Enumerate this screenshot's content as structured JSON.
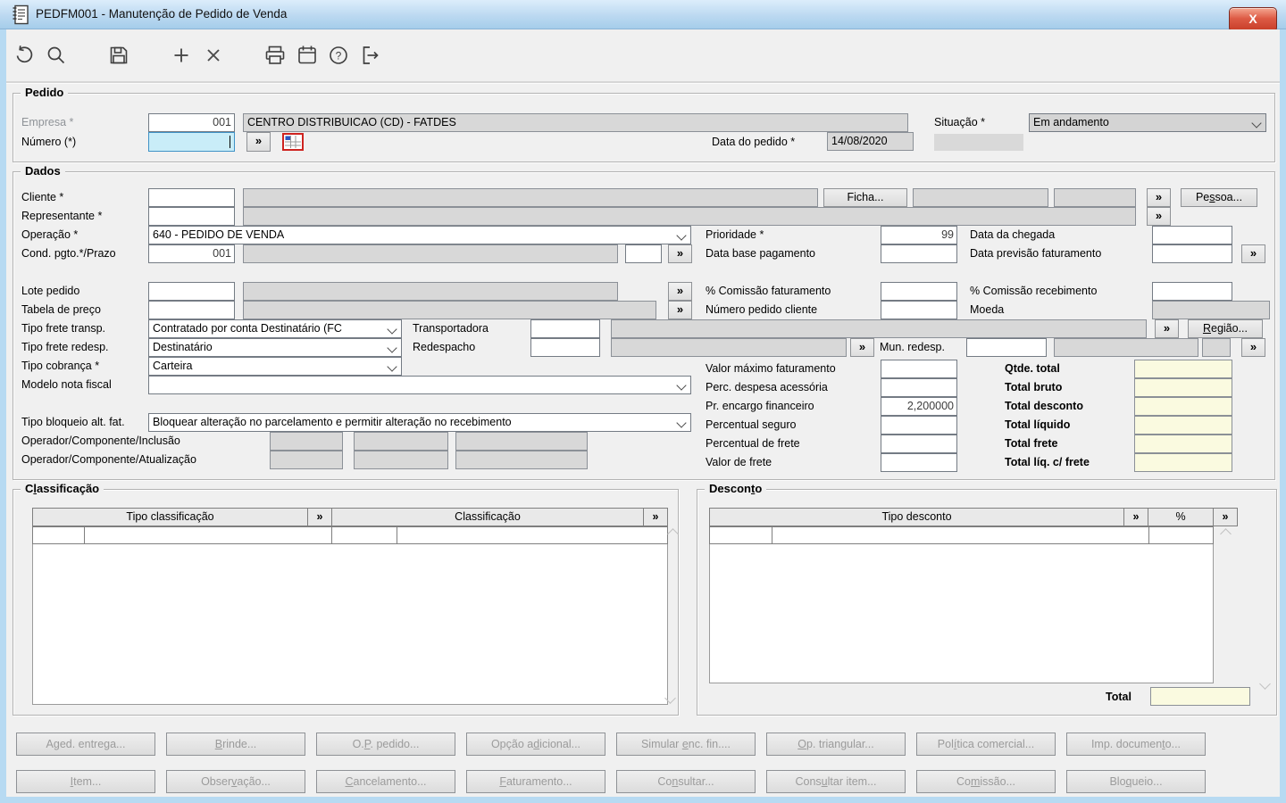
{
  "window": {
    "title": "PEDFM001 - Manutenção de Pedido de Venda",
    "close_glyph": "X"
  },
  "ui": {
    "lookup": "»"
  },
  "toolbar": {
    "icon_names": [
      "undo-icon",
      "search-icon",
      "save-icon",
      "add-icon",
      "cancel-icon",
      "print-icon",
      "calendar-icon",
      "help-icon",
      "exit-icon"
    ]
  },
  "pedido": {
    "legend": "Pedido",
    "empresa": {
      "label": "Empresa *",
      "code": "001",
      "name": "CENTRO DISTRIBUICAO (CD) - FATDES"
    },
    "situacao": {
      "label": "Situação *",
      "value": "Em andamento"
    },
    "numero": {
      "label": "Número (*)",
      "value": ""
    },
    "data_pedido": {
      "label": "Data do pedido *",
      "value": "14/08/2020"
    }
  },
  "dados": {
    "legend": "Dados",
    "cliente": {
      "label": "Cliente *",
      "code": "",
      "name": ""
    },
    "ficha_button": "Ficha...",
    "pessoa_button": {
      "label": "Pessoa...",
      "u": 2
    },
    "representante": {
      "label": "Representante *",
      "code": "",
      "name": ""
    },
    "operacao": {
      "label": "Operação *",
      "value": "640 - PEDIDO DE VENDA"
    },
    "prioridade": {
      "label": "Prioridade *",
      "value": "99"
    },
    "data_chegada": {
      "label": "Data da chegada",
      "value": ""
    },
    "cond_pgto": {
      "label": "Cond. pgto.*/Prazo",
      "value": "001"
    },
    "data_base_pagamento": {
      "label": "Data base pagamento",
      "value": ""
    },
    "data_previsao": {
      "label": "Data previsão faturamento",
      "value": ""
    },
    "lote_pedido": {
      "label": "Lote pedido",
      "value": ""
    },
    "comissao_faturamento": {
      "label": "% Comissão faturamento",
      "value": ""
    },
    "comissao_recebimento": {
      "label": "% Comissão recebimento",
      "value": ""
    },
    "tabela_preco": {
      "label": "Tabela de preço",
      "value": ""
    },
    "numero_pedido_cliente": {
      "label": "Número pedido cliente",
      "value": ""
    },
    "moeda": {
      "label": "Moeda",
      "value": ""
    },
    "tipo_frete_transp": {
      "label": "Tipo frete transp.",
      "value": "Contratado por conta Destinatário (FC"
    },
    "transportadora": {
      "label": "Transportadora",
      "value": ""
    },
    "regiao_button": {
      "label": "Região...",
      "u": 0
    },
    "tipo_frete_redesp": {
      "label": "Tipo frete redesp.",
      "value": "Destinatário"
    },
    "redespacho": {
      "label": "Redespacho",
      "value": ""
    },
    "mun_redesp": {
      "label": "Mun. redesp.",
      "value": ""
    },
    "tipo_cobranca": {
      "label": "Tipo cobrança *",
      "value": "Carteira"
    },
    "modelo_nota_fiscal": {
      "label": "Modelo nota fiscal",
      "value": ""
    },
    "tipo_bloqueio": {
      "label": "Tipo bloqueio alt. fat.",
      "value": "Bloquear alteração no parcelamento e permitir alteração no recebimento"
    },
    "operador_inclusao_label": "Operador/Componente/Inclusão",
    "operador_atualizacao_label": "Operador/Componente/Atualização",
    "valor_maximo": {
      "label": "Valor máximo faturamento",
      "value": ""
    },
    "perc_despesa": {
      "label": "Perc. despesa acessória",
      "value": ""
    },
    "pr_encargo": {
      "label": "Pr. encargo financeiro",
      "value": "2,200000"
    },
    "perc_seguro": {
      "label": "Percentual seguro",
      "value": ""
    },
    "perc_frete": {
      "label": "Percentual de frete",
      "value": ""
    },
    "valor_frete": {
      "label": "Valor de frete",
      "value": ""
    },
    "totais": {
      "qtde_total": {
        "label": "Qtde. total",
        "value": ""
      },
      "total_bruto": {
        "label": "Total bruto",
        "value": ""
      },
      "total_desconto": {
        "label": "Total desconto",
        "value": ""
      },
      "total_liquido": {
        "label": "Total líquido",
        "value": ""
      },
      "total_frete": {
        "label": "Total frete",
        "value": ""
      },
      "total_liq_frete": {
        "label": "Total líq. c/ frete",
        "value": ""
      }
    }
  },
  "classificacao": {
    "legend": {
      "label": "Classificação",
      "u": 1
    },
    "columns": [
      "Tipo classificação",
      "Classificação"
    ]
  },
  "desconto": {
    "legend": {
      "label": "Desconto",
      "u": 6
    },
    "columns": [
      "Tipo desconto",
      "%"
    ],
    "total": {
      "label": "Total",
      "value": ""
    }
  },
  "action_buttons": {
    "row1": [
      {
        "label": "Aged. entrega...",
        "u": 1
      },
      {
        "label": "Brinde...",
        "u": 0
      },
      {
        "label": "O.P. pedido...",
        "u": 2
      },
      {
        "label": "Opção adicional...",
        "u": 7
      },
      {
        "label": "Simular enc. fin....",
        "u": 8
      },
      {
        "label": "Op. triangular...",
        "u": 0
      },
      {
        "label": "Política comercial...",
        "u": 3
      },
      {
        "label": "Imp. documento...",
        "u": 12
      }
    ],
    "row2": [
      {
        "label": "Item...",
        "u": 0
      },
      {
        "label": "Observação...",
        "u": 5
      },
      {
        "label": "Cancelamento...",
        "u": 0
      },
      {
        "label": "Faturamento...",
        "u": 0
      },
      {
        "label": "Consultar...",
        "u": 2
      },
      {
        "label": "Consultar item...",
        "u": 4
      },
      {
        "label": "Comissão...",
        "u": 2
      },
      {
        "label": "Bloqueio...",
        "u": 3
      }
    ]
  }
}
